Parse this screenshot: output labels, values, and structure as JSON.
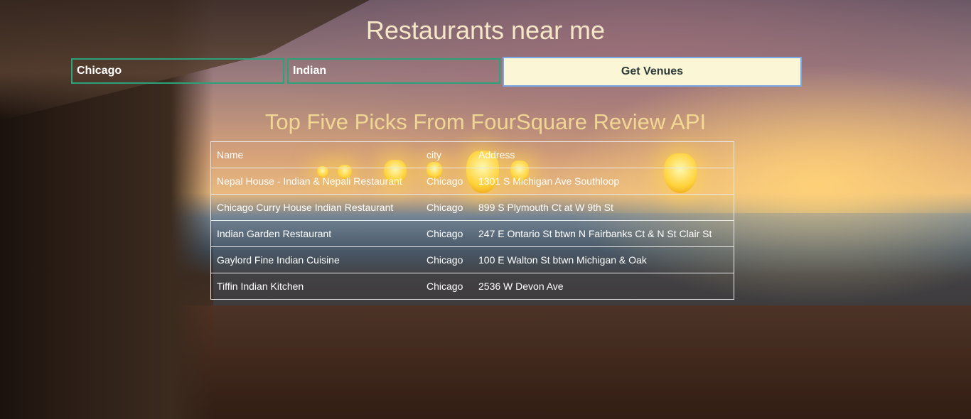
{
  "page": {
    "title": "Restaurants near me",
    "subtitle": "Top Five Picks From FourSquare Review API"
  },
  "search": {
    "city_value": "Chicago",
    "cuisine_value": "Indian",
    "button_label": "Get Venues"
  },
  "table": {
    "headers": [
      "Name",
      "city",
      "Address"
    ],
    "rows": [
      [
        "Nepal House - Indian & Nepali Restaurant",
        "Chicago",
        "1301 S Michigan Ave Southloop"
      ],
      [
        "Chicago Curry House Indian Restaurant",
        "Chicago",
        "899 S Plymouth Ct at W 9th St"
      ],
      [
        "Indian Garden Restaurant",
        "Chicago",
        "247 E Ontario St btwn N Fairbanks Ct & N St Clair St"
      ],
      [
        "Gaylord Fine Indian Cuisine",
        "Chicago",
        "100 E Walton St btwn Michigan & Oak"
      ],
      [
        "Tiffin Indian Kitchen",
        "Chicago",
        "2536 W Devon Ave"
      ]
    ]
  },
  "colors": {
    "input_border": "#2aa37a",
    "button_bg": "#fbf7d6",
    "button_border": "#7aa7e6",
    "title_color": "#f5e6c8",
    "subtitle_color": "#ffe89a"
  }
}
